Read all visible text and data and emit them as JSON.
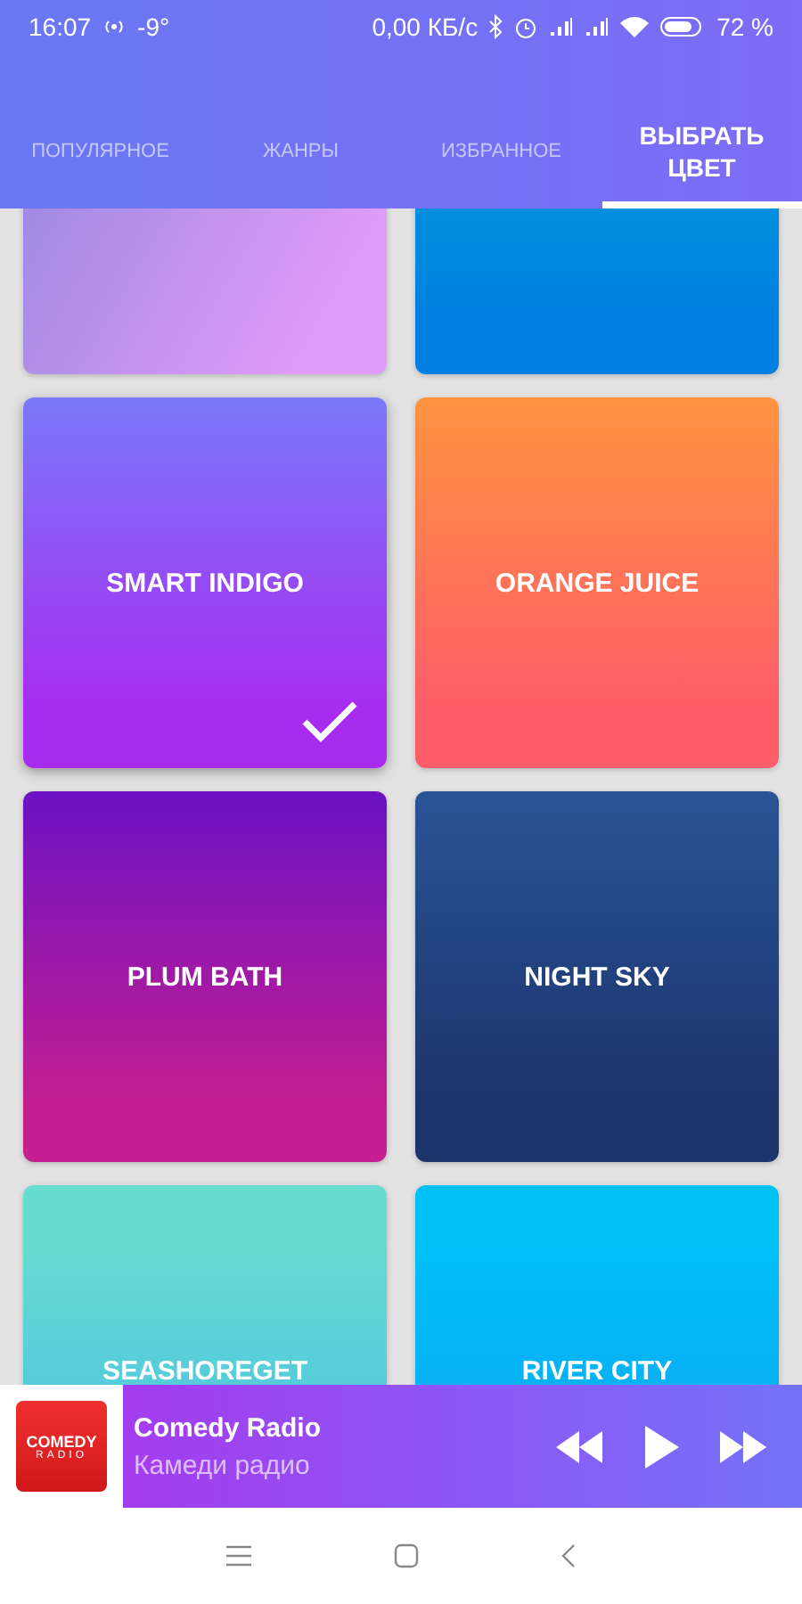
{
  "status_bar": {
    "time": "16:07",
    "weather": "-9°",
    "speed": "0,00 КБ/с",
    "battery": "72 %"
  },
  "tabs": [
    {
      "label": "ПОПУЛЯРНОЕ",
      "selected": false
    },
    {
      "label": "ЖАНРЫ",
      "selected": false
    },
    {
      "label": "ИЗБРАННОЕ",
      "selected": false
    },
    {
      "label": "ВЫБРАТЬ ЦВЕТ",
      "selected": true
    }
  ],
  "themes": [
    {
      "color": "#e09cf8",
      "selected": false
    },
    {
      "color": "#0080e0",
      "selected": false
    },
    {
      "name": "SMART INDIGO",
      "color": "#a72cf0",
      "selected": true
    },
    {
      "name": "ORANGE JUICE",
      "color": "#ff5c6a",
      "selected": false
    },
    {
      "name": "PLUM BATH",
      "color": "#c41e90",
      "selected": false
    },
    {
      "name": "NIGHT SKY",
      "color": "#1c346c",
      "selected": false
    },
    {
      "name": "SEASHOREGET",
      "color": "#68dcd0",
      "selected": false
    },
    {
      "name": "RIVER CITY",
      "color": "#00c0f8",
      "selected": false
    }
  ],
  "player": {
    "logo_top": "COMEDY",
    "logo_bottom": "RADIO",
    "title": "Comedy Radio",
    "subtitle": "Камеди радио"
  }
}
